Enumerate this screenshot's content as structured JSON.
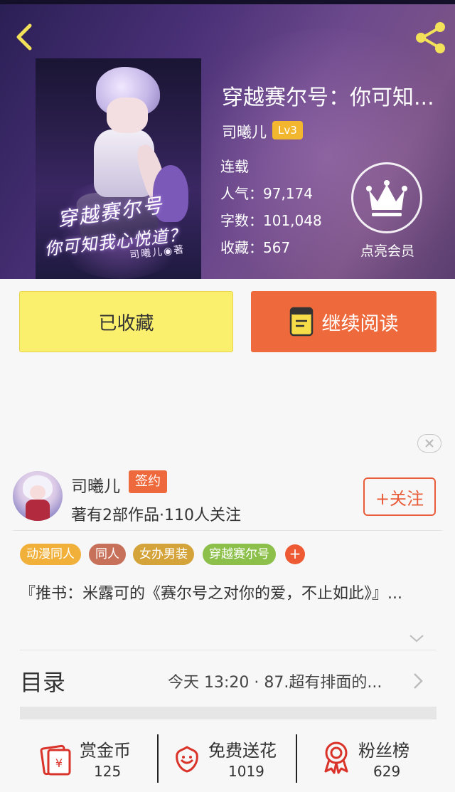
{
  "book": {
    "title": "穿越赛尔号：你可知...",
    "author": "司曦儿",
    "author_level": "Lv3",
    "status": "连载",
    "popularity_label": "人气：",
    "popularity": "97,174",
    "word_count_label": "字数：",
    "word_count": "101,048",
    "favorites_label": "收藏：",
    "favorites": "567",
    "cover": {
      "title_line1": "穿越赛尔号",
      "title_line2": "你可知我心悦道？",
      "signature": "司曦儿◉著"
    }
  },
  "vip": {
    "label": "点亮会员",
    "icon": "crown-icon"
  },
  "actions": {
    "favorited_label": "已收藏",
    "continue_label": "继续阅读"
  },
  "writer": {
    "name": "司曦儿",
    "signed_badge": "签约",
    "stats": "著有2部作品·110人关注",
    "follow_label": "+关注"
  },
  "tags": [
    {
      "label": "动漫同人",
      "color": "#f0b03a"
    },
    {
      "label": "同人",
      "color": "#c8715a"
    },
    {
      "label": "女办男装",
      "color": "#d4a33a"
    },
    {
      "label": "穿越赛尔号",
      "color": "#8cc04a"
    }
  ],
  "tag_add_label": "+",
  "description": "『推书：米露可的《赛尔号之对你的爱，不止如此》』...",
  "toc": {
    "label": "目录",
    "latest": "今天 13:20 · 87.超有排面的..."
  },
  "stats": [
    {
      "label": "赏金币",
      "value": "125",
      "icon": "reward-coin-icon"
    },
    {
      "label": "免费送花",
      "value": "1019",
      "icon": "flower-icon"
    },
    {
      "label": "粉丝榜",
      "value": "629",
      "icon": "ranking-medal-icon"
    }
  ],
  "colors": {
    "accent": "#ee6a3c",
    "favorite_button": "#fbf06d",
    "level_badge": "#f2b72f",
    "icon_accent": "#d9332a"
  }
}
